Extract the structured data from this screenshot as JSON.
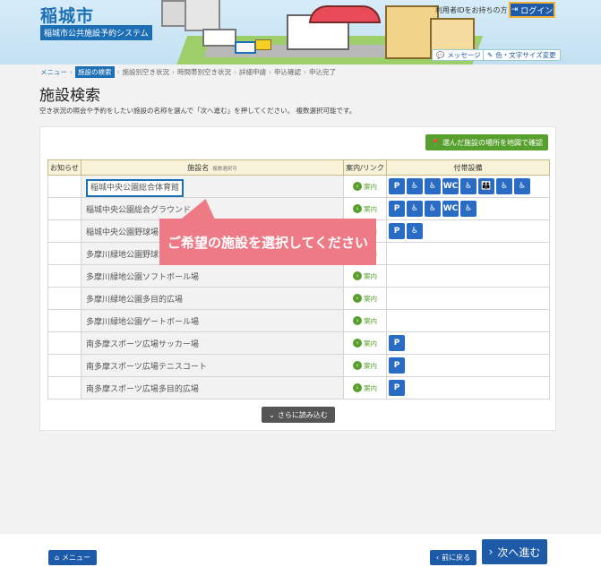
{
  "header": {
    "city_name": "稲城市",
    "system_name": "稲城市公共施設予約システム",
    "login_prompt": "利用者IDをお持ちの方",
    "login_label": "ログイン",
    "message_label": "メッセージ",
    "font_label": "色・文字サイズ変更"
  },
  "breadcrumb": {
    "menu": "メニュー",
    "current": "施設の検索",
    "steps": [
      "施設別空き状況",
      "時間帯別空き状況",
      "詳細申請",
      "申込確認",
      "申込完了"
    ]
  },
  "page": {
    "title": "施設検索",
    "description": "空き状況の照会や予約をしたい施設の名称を選んで「次へ進む」を押してください。 複数選択可能です。"
  },
  "map_button_label": "選んだ施設の場所を地図で確認",
  "table": {
    "headers": {
      "notice": "お知らせ",
      "name": "施設名",
      "name_sub": "複数選択可",
      "link": "案内/リンク",
      "amenities": "付帯設備"
    },
    "guide_label": "案内",
    "rows": [
      {
        "name": "稲城中央公園総合体育館",
        "amenities": [
          "P",
          "♿",
          "♿",
          "WC",
          "♿",
          "👪",
          "♿",
          "♿"
        ]
      },
      {
        "name": "稲城中央公園総合グラウンド",
        "amenities": [
          "P",
          "♿",
          "♿",
          "WC",
          "♿"
        ]
      },
      {
        "name": "稲城中央公園野球場",
        "amenities": [
          "P",
          "♿"
        ]
      },
      {
        "name": "多摩川緑地公園野球場",
        "amenities": []
      },
      {
        "name": "多摩川緑地公園ソフトボール場",
        "amenities": []
      },
      {
        "name": "多摩川緑地公園多目的広場",
        "amenities": []
      },
      {
        "name": "多摩川緑地公園ゲートボール場",
        "amenities": []
      },
      {
        "name": "南多摩スポーツ広場サッカー場",
        "amenities": [
          "P"
        ]
      },
      {
        "name": "南多摩スポーツ広場テニスコート",
        "amenities": [
          "P"
        ]
      },
      {
        "name": "南多摩スポーツ広場多目的広場",
        "amenities": [
          "P"
        ]
      }
    ]
  },
  "more_label": "さらに読み込む",
  "tooltip": "ご希望の施設を選択してください",
  "footer": {
    "menu_label": "メニュー",
    "back_label": "前に戻る",
    "next_label": "次へ進む"
  },
  "colors": {
    "primary": "#1d5aa8",
    "accent_green": "#58a02d",
    "tooltip_pink": "#ee7a86",
    "table_header_bg": "#f8f3d8"
  }
}
